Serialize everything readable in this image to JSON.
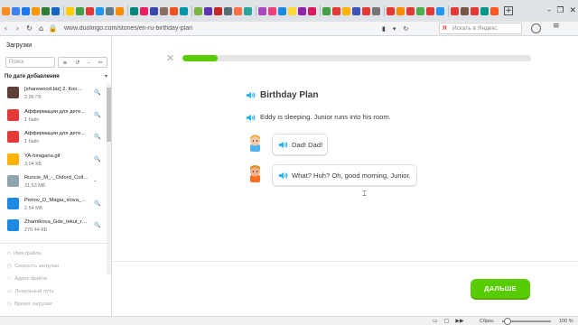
{
  "browser": {
    "address": {
      "url": "www.duolingo.com/stories/en-ru-birthday-plan",
      "search_placeholder": "Искать в Яндекс",
      "search_logo": "Я"
    },
    "new_tab_symbol": "+",
    "window_controls": [
      "–",
      "❐",
      "✕"
    ],
    "menu_symbol": "≡",
    "tab_icon_colors": [
      "#ff8a1f",
      "#3b82f6",
      "#1877f2",
      "#ff9800",
      "#2e7d32",
      "#1565c0",
      "#ffcc00",
      "#43a047",
      "#e53935",
      "#2196f3",
      "#607d8b",
      "#fb8c00",
      "#00897b",
      "#e91e63",
      "#3949ab",
      "#8d6e63",
      "#f4511e",
      "#0097a7",
      "#7cb342",
      "#5e35b1",
      "#c62828",
      "#546e7a",
      "#ff7043",
      "#26a69a",
      "#ab47bc",
      "#ec407a",
      "#1e88e5",
      "#fdd835",
      "#8e24aa",
      "#d81b60",
      "#43a047",
      "#e53935",
      "#ffb300",
      "#3f51b5",
      "#e53935",
      "#757575",
      "#e53935",
      "#fb8c00",
      "#e53935",
      "#4caf50",
      "#e53935",
      "#2196f3",
      "#e53935",
      "#795548",
      "#e53935",
      "#009688",
      "#ff5722"
    ]
  },
  "downloads": {
    "title": "Загрузки",
    "search_placeholder": "Поиск",
    "tool_icons": [
      "≡",
      "↺",
      "–",
      "✂"
    ],
    "sort_label": "По дате добавления",
    "sort_arrow": "▾",
    "items": [
      {
        "name": "[sharewood.biz] 2. Кон…",
        "size": "2,96 ГБ",
        "color": "#5d4037",
        "action": "🔍"
      },
      {
        "name": "Аффирмации для дете…",
        "size": "1 байт",
        "color": "#e53935",
        "action": "🔍"
      },
      {
        "name": "Аффирмации для дете…",
        "size": "1 байт",
        "color": "#e53935",
        "action": "🔍"
      },
      {
        "name": "YA-hiragana.gif",
        "size": "3,04 КБ",
        "color": "#ffb300",
        "action": "🔍"
      },
      {
        "name": "Runcie_M_-_Oxford_Coll…",
        "size": "31,53 МБ",
        "color": "#90a4ae",
        "action": "–"
      },
      {
        "name": "Petrov_D_Magia_slova_…",
        "size": "2,54 МБ",
        "color": "#1e88e5",
        "action": "🔍"
      },
      {
        "name": "Zharnikova_Gde_tekut_r…",
        "size": "270,44 КБ",
        "color": "#1e88e5",
        "action": "🔍"
      }
    ],
    "details": [
      {
        "icon": "▫",
        "label": "Имя файла"
      },
      {
        "icon": "◷",
        "label": "Скорость загрузки"
      },
      {
        "icon": "◌",
        "label": "Адрес файла"
      },
      {
        "icon": "▭",
        "label": "Локальный путь"
      },
      {
        "icon": "◷",
        "label": "Время загрузки"
      }
    ]
  },
  "story": {
    "close_symbol": "✕",
    "progress": 0.1,
    "title": "Birthday Plan",
    "narration": "Eddy is sleeping. Junior runs into his room.",
    "lines": [
      {
        "speaker": "junior",
        "text": "Dad! Dad!"
      },
      {
        "speaker": "eddy",
        "text": "What? Huh? Oh, good morning, Junior."
      }
    ],
    "cursor_symbol": "⌶",
    "continue_label": "ДАЛЬШЕ",
    "accent_color": "#58cc02",
    "speaker_color": "#1cb0f6"
  },
  "statusbar": {
    "icons": [
      "▭",
      "▢",
      "▶▶"
    ],
    "reset_label": "Сброс",
    "zoom_label": "100 %",
    "zoom_level": 0.12
  }
}
